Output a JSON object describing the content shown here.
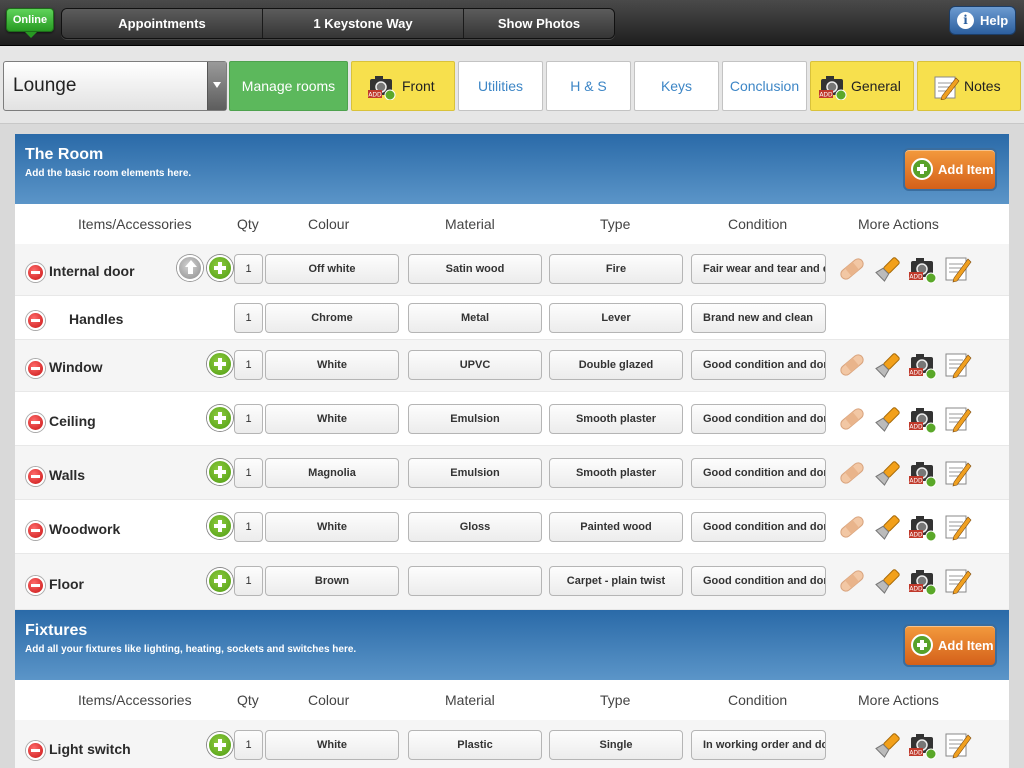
{
  "topbar": {
    "status": "Online",
    "segments": [
      "Appointments",
      "1 Keystone Way",
      "Show Photos"
    ],
    "help": "Help"
  },
  "roombar": {
    "room": "Lounge",
    "tabs": [
      "Manage rooms",
      "Front",
      "Utilities",
      "H & S",
      "Keys",
      "Conclusion",
      "General",
      "Notes"
    ]
  },
  "columns": [
    "Items/Accessories",
    "Qty",
    "Colour",
    "Material",
    "Type",
    "Condition",
    "More Actions"
  ],
  "sections": [
    {
      "title": "The Room",
      "subtitle": "Add the basic room elements here.",
      "add_label": "Add Item",
      "rows": [
        {
          "name": "Internal door",
          "qty": "1",
          "colour": "Off white",
          "material": "Satin wood",
          "type": "Fire",
          "condition": "Fair wear and tear and e"
        },
        {
          "name": "Handles",
          "qty": "1",
          "colour": "Chrome",
          "material": "Metal",
          "type": "Lever",
          "condition": "Brand new and clean"
        },
        {
          "name": "Window",
          "qty": "1",
          "colour": "White",
          "material": "UPVC",
          "type": "Double glazed",
          "condition": "Good condition and dor"
        },
        {
          "name": "Ceiling",
          "qty": "1",
          "colour": "White",
          "material": "Emulsion",
          "type": "Smooth plaster",
          "condition": "Good condition and dor"
        },
        {
          "name": "Walls",
          "qty": "1",
          "colour": "Magnolia",
          "material": "Emulsion",
          "type": "Smooth plaster",
          "condition": "Good condition and dor"
        },
        {
          "name": "Woodwork",
          "qty": "1",
          "colour": "White",
          "material": "Gloss",
          "type": "Painted wood",
          "condition": "Good condition and dor"
        },
        {
          "name": "Floor",
          "qty": "1",
          "colour": "Brown",
          "material": "",
          "type": "Carpet - plain twist",
          "condition": "Good condition and dor"
        }
      ]
    },
    {
      "title": "Fixtures",
      "subtitle": "Add all your fixtures like lighting, heating, sockets and switches here.",
      "add_label": "Add Item",
      "rows": [
        {
          "name": "Light switch",
          "qty": "1",
          "colour": "White",
          "material": "Plastic",
          "type": "Single",
          "condition": "In working order and do"
        }
      ]
    }
  ],
  "icons": {
    "bandage": "bandage-icon",
    "torch": "torch-icon",
    "camera_add": "add-photo-icon",
    "notepad": "notepad-icon",
    "add_tag": "ADD"
  },
  "colors": {
    "green_tab": "#5cb85c",
    "yellow_tab": "#f7e04d",
    "header_blue": "#2a6aa8",
    "add_orange": "#e67e22"
  }
}
